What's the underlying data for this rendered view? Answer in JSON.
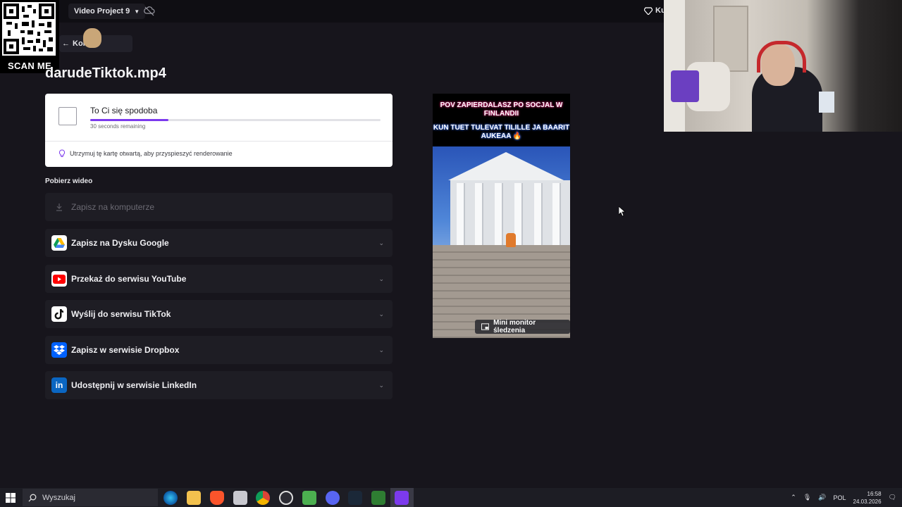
{
  "header": {
    "project_name": "Video Project 9",
    "right_label": "Ku"
  },
  "overlay": {
    "qr_label": "SCAN ME",
    "back_label": "Konty"
  },
  "file_title": "darudeTiktok.mp4",
  "render_card": {
    "title": "To Ci się spodoba",
    "progress": 0.27,
    "remaining": "30 seconds remaining",
    "tip": "Utrzymuj tę kartę otwartą, aby przyspieszyć renderowanie"
  },
  "download_section": {
    "title": "Pobierz wideo",
    "options": [
      {
        "label": "Zapisz na komputerze",
        "icon": "download-icon",
        "disabled": true
      },
      {
        "label": "Zapisz na Dysku Google",
        "icon": "google-drive-icon"
      },
      {
        "label": "Przekaż do serwisu YouTube",
        "icon": "youtube-icon"
      },
      {
        "label": "Wyślij do serwisu TikTok",
        "icon": "tiktok-icon"
      },
      {
        "label": "Zapisz w serwisie Dropbox",
        "icon": "dropbox-icon"
      },
      {
        "label": "Udostępnij w serwisie LinkedIn",
        "icon": "linkedin-icon"
      }
    ]
  },
  "preview": {
    "caption_line1": "POV ZAPIERDALASZ PO SOCJAL W FINLANDII",
    "caption_line2": "KUN TUET TULEVAT TILILLE JA BAARIT AUKEAA 🔥",
    "badge": "Mini monitor śledzenia"
  },
  "taskbar": {
    "search_placeholder": "Wyszukaj",
    "language": "POL",
    "time": "16:58",
    "date": "24.03.2026"
  },
  "colors": {
    "accent": "#7c3aed",
    "background": "#17151c",
    "option_bg": "#1e1d24"
  }
}
